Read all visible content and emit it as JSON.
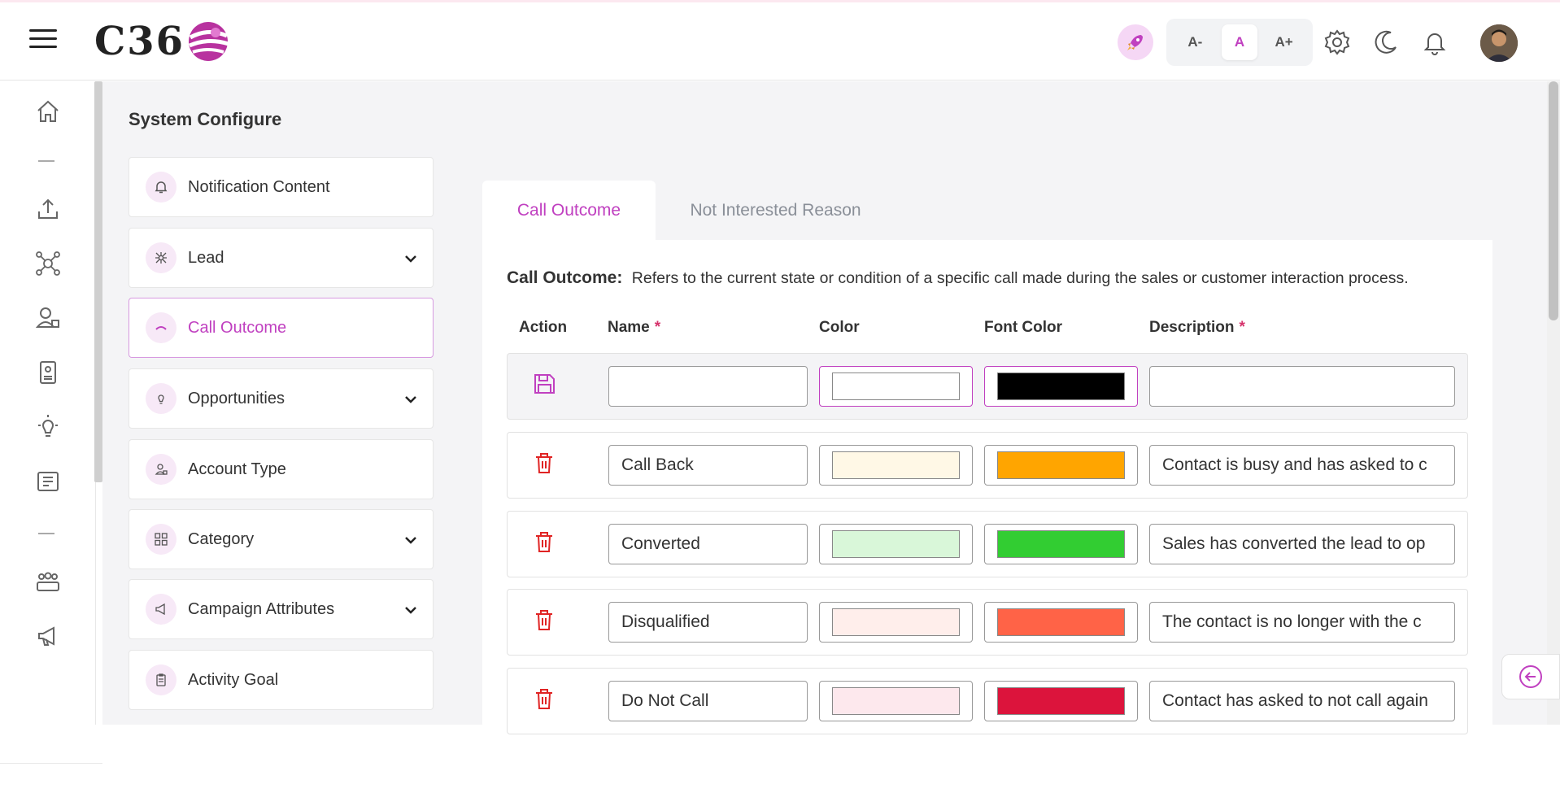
{
  "app": {
    "logo_text": "C36"
  },
  "header": {
    "font_small": "A-",
    "font_normal": "A",
    "font_large": "A+"
  },
  "page": {
    "title": "System Configure"
  },
  "menu": {
    "items": [
      {
        "label": "Notification Content",
        "icon": "bell-icon",
        "expandable": false,
        "active": false
      },
      {
        "label": "Lead",
        "icon": "network-icon",
        "expandable": true,
        "active": false
      },
      {
        "label": "Call Outcome",
        "icon": "phone-hangup-icon",
        "expandable": false,
        "active": true
      },
      {
        "label": "Opportunities",
        "icon": "lightbulb-icon",
        "expandable": true,
        "active": false
      },
      {
        "label": "Account Type",
        "icon": "user-card-icon",
        "expandable": false,
        "active": false
      },
      {
        "label": "Category",
        "icon": "grid-icon",
        "expandable": true,
        "active": false
      },
      {
        "label": "Campaign Attributes",
        "icon": "megaphone-icon",
        "expandable": true,
        "active": false
      },
      {
        "label": "Activity Goal",
        "icon": "clipboard-icon",
        "expandable": false,
        "active": false
      }
    ]
  },
  "tabs": [
    {
      "label": "Call Outcome",
      "active": true
    },
    {
      "label": "Not Interested Reason",
      "active": false
    }
  ],
  "description": {
    "term": "Call Outcome:",
    "text": "Refers to the current state or condition of a specific call made during the sales or customer interaction process."
  },
  "table": {
    "headers": {
      "action": "Action",
      "name": "Name",
      "color": "Color",
      "font_color": "Font Color",
      "description": "Description",
      "required_mark": "*"
    },
    "new_row": {
      "name": "",
      "color": "#ffffff",
      "font_color": "#000000",
      "description": ""
    },
    "rows": [
      {
        "name": "Call Back",
        "color": "#fff8e6",
        "font_color": "#ffa500",
        "description": "Contact is busy and has asked to c"
      },
      {
        "name": "Converted",
        "color": "#d9f7d9",
        "font_color": "#32cd32",
        "description": "Sales has converted the lead to op"
      },
      {
        "name": "Disqualified",
        "color": "#ffeeeb",
        "font_color": "#ff6347",
        "description": "The contact is no longer with the c"
      },
      {
        "name": "Do Not Call",
        "color": "#fde8ed",
        "font_color": "#dc143c",
        "description": "Contact has asked to not call again"
      }
    ]
  },
  "colors": {
    "accent": "#c040c0",
    "danger": "#e02424"
  }
}
